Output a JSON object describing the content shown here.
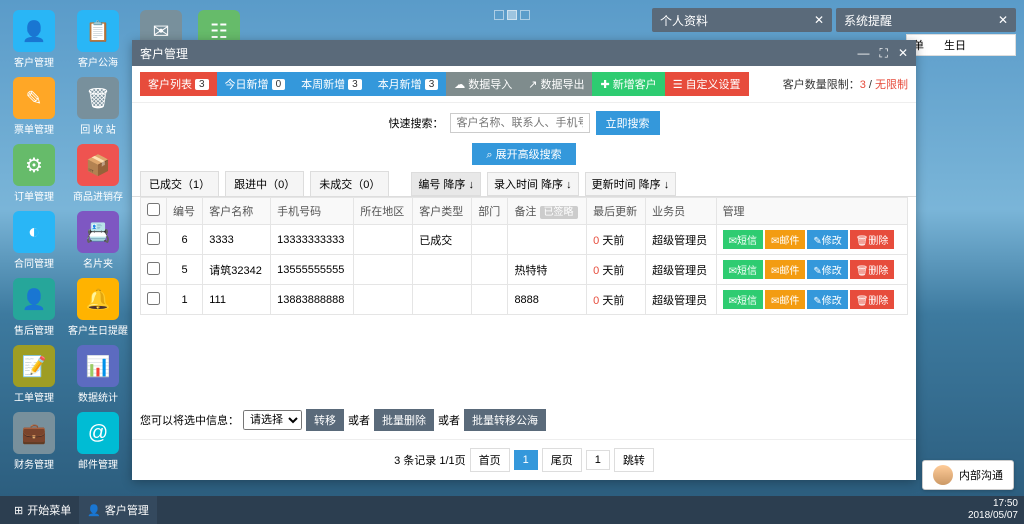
{
  "desktop": {
    "icons": [
      [
        {
          "label": "客户管理",
          "color": "c-blue",
          "glyph": "👤"
        },
        {
          "label": "客户公海",
          "color": "c-blue",
          "glyph": "📋"
        }
      ],
      [
        {
          "label": "票单管理",
          "color": "c-orange",
          "glyph": "✎"
        },
        {
          "label": "回 收 站",
          "color": "c-gray",
          "glyph": "🗑"
        }
      ],
      [
        {
          "label": "订单管理",
          "color": "c-green",
          "glyph": "⚙"
        },
        {
          "label": "商品进销存",
          "color": "c-red",
          "glyph": "📦"
        }
      ],
      [
        {
          "label": "合同管理",
          "color": "c-blue",
          "glyph": "◐"
        },
        {
          "label": "名片夹",
          "color": "c-purple",
          "glyph": "📇"
        }
      ],
      [
        {
          "label": "售后管理",
          "color": "c-teal",
          "glyph": "👤"
        },
        {
          "label": "客户生日提醒",
          "color": "c-yellow",
          "glyph": "🔔"
        }
      ],
      [
        {
          "label": "工单管理",
          "color": "c-olive",
          "glyph": "📝"
        },
        {
          "label": "数据统计",
          "color": "c-indigo",
          "glyph": "📊"
        }
      ],
      [
        {
          "label": "财务管理",
          "color": "c-gray",
          "glyph": "💼"
        },
        {
          "label": "邮件管理",
          "color": "c-cyan",
          "glyph": "@"
        }
      ]
    ],
    "top_icons": [
      {
        "glyph": "✉",
        "color": "c-gray"
      },
      {
        "glyph": "☷",
        "color": "c-green"
      }
    ]
  },
  "top_panels": {
    "p1": "个人资料",
    "p2": "系统提醒",
    "sub1": "单",
    "sub2": "生日"
  },
  "win": {
    "title": "客户管理",
    "toolbar": {
      "list": "客户列表",
      "list_badge": "3",
      "today": "今日新增",
      "today_badge": "0",
      "week": "本周新增",
      "week_badge": "3",
      "month": "本月新增",
      "month_badge": "3",
      "import": "数据导入",
      "export": "数据导出",
      "add": "新增客户",
      "custom": "自定义设置",
      "limit_label": "客户数量限制：",
      "limit_used": "3",
      "limit_sep": " / ",
      "limit_total": "无限制"
    },
    "search": {
      "label": "快速搜索：",
      "placeholder": "客户名称、联系人、手机号码",
      "btn": "立即搜索",
      "adv": "展开高级搜索"
    },
    "tabs": {
      "t1": "已成交（1）",
      "t2": "跟进中（0）",
      "t3": "未成交（0）",
      "s1": "编号 降序 ↓",
      "s2": "录入时间 降序 ↓",
      "s3": "更新时间 降序 ↓"
    },
    "table": {
      "headers": {
        "num": "编号",
        "name": "客户名称",
        "phone": "手机号码",
        "area": "所在地区",
        "type": "客户类型",
        "dept": "部门",
        "remark": "备注",
        "remark_badge": "已签略",
        "update": "最后更新",
        "sales": "业务员",
        "ops": "管理"
      },
      "rows": [
        {
          "num": "6",
          "name": "3333",
          "phone": "13333333333",
          "area": "",
          "type": "已成交",
          "dept": "",
          "remark": "",
          "update": "0 天前",
          "sales": "超级管理员"
        },
        {
          "num": "5",
          "name": "请筑32342",
          "phone": "13555555555",
          "area": "",
          "type": "",
          "dept": "",
          "remark": "热特特",
          "update": "0 天前",
          "sales": "超级管理员"
        },
        {
          "num": "1",
          "name": "111",
          "phone": "13883888888",
          "area": "",
          "type": "",
          "dept": "",
          "remark": "8888",
          "update": "0 天前",
          "sales": "超级管理员"
        }
      ],
      "ops": {
        "sms": "短信",
        "mail": "邮件",
        "edit": "修改",
        "del": "删除"
      }
    },
    "batch": {
      "label": "您可以将选中信息：",
      "select": "请选择",
      "move": "转移",
      "or": "或者",
      "bdel": "批量删除",
      "bmove": "批量转移公海"
    },
    "pager": {
      "info": "3 条记录 1/1页",
      "first": "首页",
      "cur": "1",
      "last": "尾页",
      "page_input": "1",
      "jump": "跳转"
    }
  },
  "chat": "内部沟通",
  "taskbar": {
    "start": "开始菜单",
    "app": "客户管理",
    "time": "17:50",
    "date": "2018/05/07"
  }
}
